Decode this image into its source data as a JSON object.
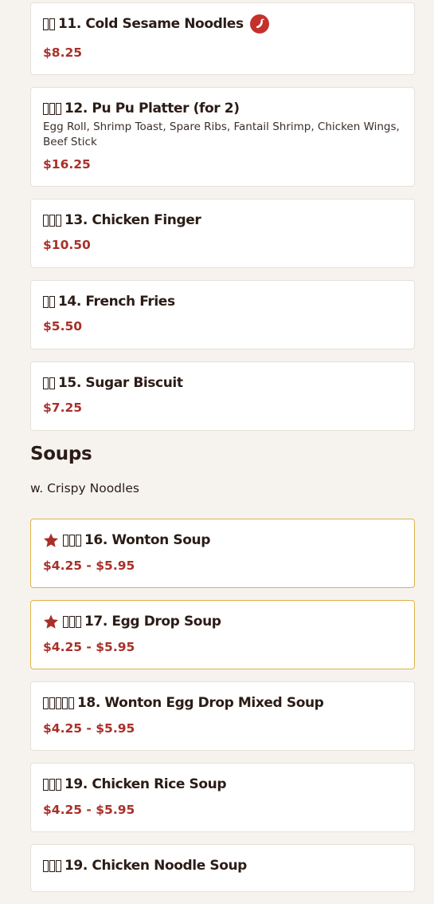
{
  "items": [
    {
      "name": "11. Cold Sesame Noodles",
      "price": "$8.25",
      "cjk_count": 2,
      "spicy": true
    },
    {
      "name": "12. Pu Pu Platter (for 2)",
      "description": "Egg Roll, Shrimp Toast, Spare Ribs, Fantail Shrimp, Chicken Wings, Beef Stick",
      "price": "$16.25",
      "cjk_count": 3
    },
    {
      "name": "13. Chicken Finger",
      "price": "$10.50",
      "cjk_count": 3
    },
    {
      "name": "14. French Fries",
      "price": "$5.50",
      "cjk_count": 2
    },
    {
      "name": "15. Sugar Biscuit",
      "price": "$7.25",
      "cjk_count": 2
    }
  ],
  "section": {
    "title": "Soups",
    "subtitle": "w. Crispy Noodles"
  },
  "soups": [
    {
      "name": "16. Wonton Soup",
      "price": "$4.25 - $5.95",
      "cjk_count": 3,
      "featured": true
    },
    {
      "name": "17. Egg Drop Soup",
      "price": "$4.25 - $5.95",
      "cjk_count": 3,
      "featured": true
    },
    {
      "name": "18. Wonton Egg Drop Mixed Soup",
      "price": "$4.25 - $5.95",
      "cjk_count": 5
    },
    {
      "name": "19. Chicken Rice Soup",
      "price": "$4.25 - $5.95",
      "cjk_count": 3
    },
    {
      "name": "19. Chicken Noodle Soup",
      "cjk_count": 3
    }
  ],
  "colors": {
    "accent": "#a8302a",
    "featured_border": "#e0b24a",
    "background": "#f6f3ef"
  },
  "icons": {
    "spicy": "chili-pepper-icon",
    "featured": "star-icon"
  }
}
